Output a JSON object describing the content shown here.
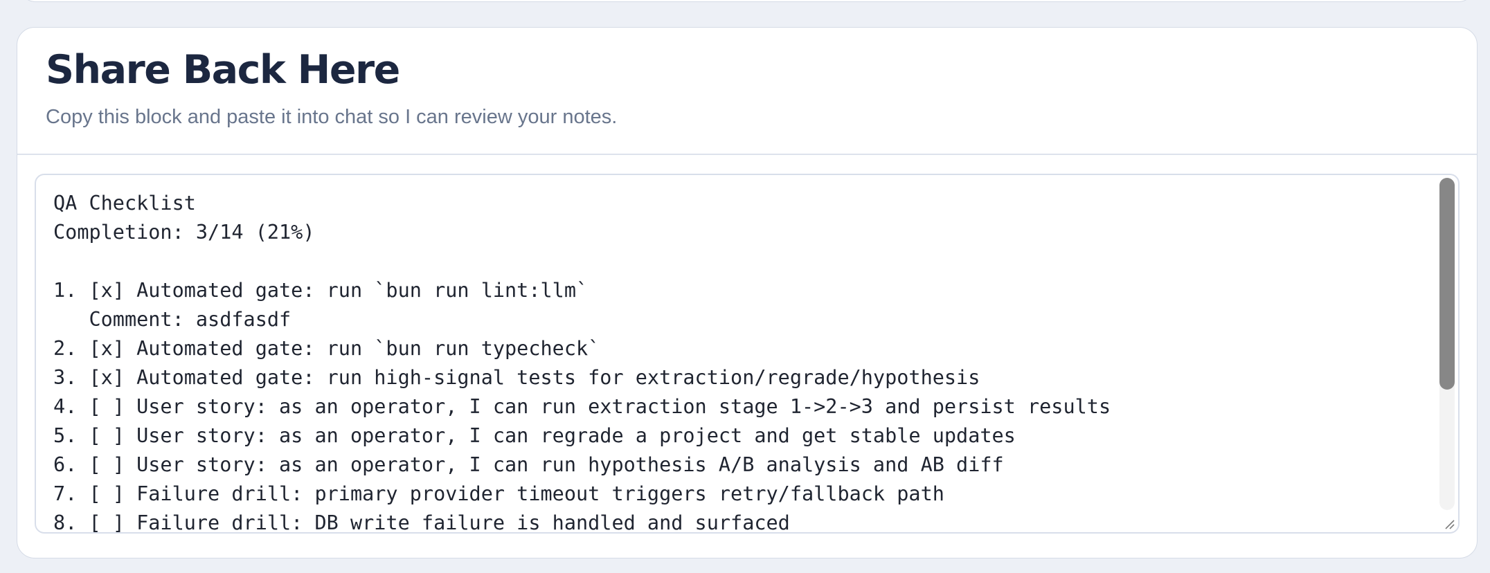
{
  "card": {
    "title": "Share Back Here",
    "subtitle": "Copy this block and paste it into chat so I can review your notes."
  },
  "checklist": {
    "text": "QA Checklist\nCompletion: 3/14 (21%)\n\n1. [x] Automated gate: run `bun run lint:llm`\n   Comment: asdfasdf\n2. [x] Automated gate: run `bun run typecheck`\n3. [x] Automated gate: run high-signal tests for extraction/regrade/hypothesis\n4. [ ] User story: as an operator, I can run extraction stage 1->2->3 and persist results\n5. [ ] User story: as an operator, I can regrade a project and get stable updates\n6. [ ] User story: as an operator, I can run hypothesis A/B analysis and AB diff\n7. [ ] Failure drill: primary provider timeout triggers retry/fallback path\n8. [ ] Failure drill: DB write failure is handled and surfaced",
    "completed": 3,
    "total": 14,
    "percent": 21
  },
  "icons": {
    "resize": "resize-grip-icon"
  },
  "colors": {
    "background": "#edf0f6",
    "card": "#ffffff",
    "title": "#1c2740",
    "subtitle": "#68758c",
    "text": "#1f2430",
    "scrollbar_thumb": "#878787"
  }
}
